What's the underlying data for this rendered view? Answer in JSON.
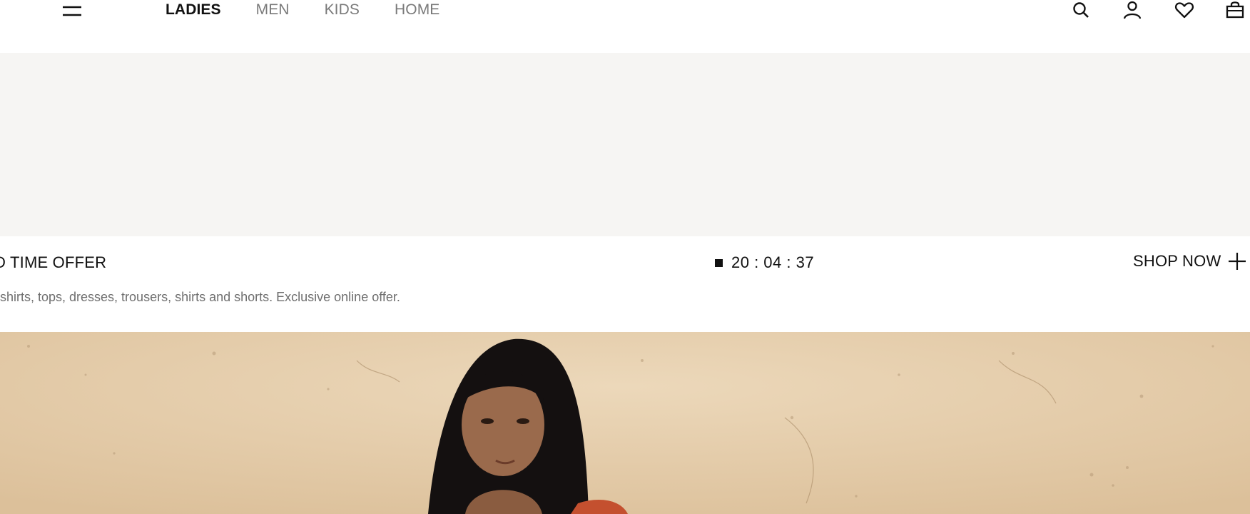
{
  "header": {
    "menu_icon": "hamburger-menu-icon",
    "nav": [
      {
        "label": "LADIES",
        "active": true
      },
      {
        "label": "MEN",
        "active": false
      },
      {
        "label": "KIDS",
        "active": false
      },
      {
        "label": "HOME",
        "active": false
      }
    ],
    "icons": [
      "search-icon",
      "account-icon",
      "heart-icon",
      "bag-icon"
    ]
  },
  "offer": {
    "title": "D TIME OFFER",
    "description": "-shirts, tops, dresses, trousers, shirts and shorts. Exclusive online offer.",
    "countdown": "20 : 04 : 37",
    "cta": "SHOP NOW"
  },
  "colors": {
    "accent": "#111111",
    "muted_text": "#6e6e6e",
    "inactive_nav": "#7a7a7a",
    "banner_background": "#f6f5f3",
    "sand": "#e8d2b2"
  }
}
